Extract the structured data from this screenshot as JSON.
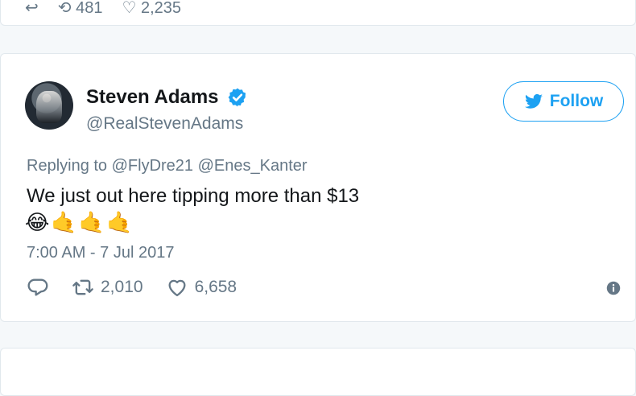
{
  "previous_tweet": {
    "retweet_count": "481",
    "like_count": "2,235"
  },
  "tweet": {
    "author": {
      "display_name": "Steven Adams",
      "handle": "@RealStevenAdams",
      "verified": true
    },
    "follow_label": "Follow",
    "replying_to": "Replying to @FlyDre21 @Enes_Kanter",
    "text": "We just out here tipping more than $13",
    "emojis": "😂🤙🤙🤙",
    "timestamp": "7:00 AM - 7 Jul 2017",
    "retweet_count": "2,010",
    "like_count": "6,658"
  },
  "colors": {
    "accent": "#1da1f2",
    "muted": "#657786",
    "background": "#f5f8fa",
    "border": "#e1e8ed"
  }
}
